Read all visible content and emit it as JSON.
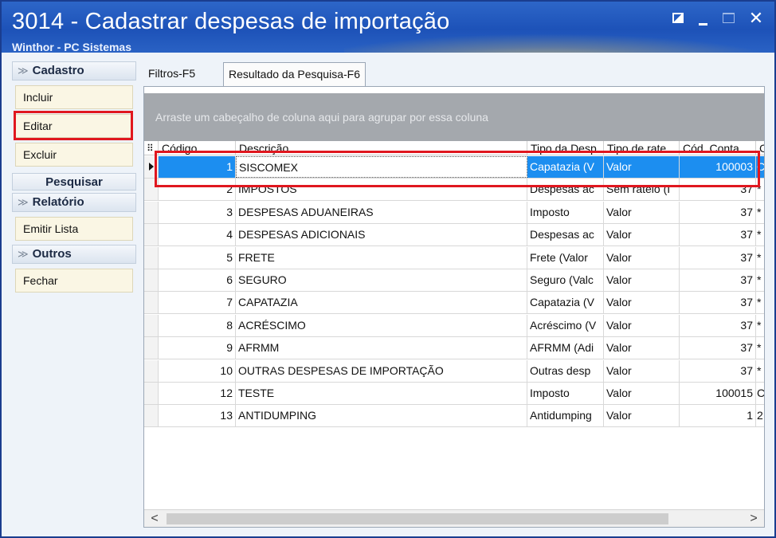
{
  "window": {
    "title": "3014 - Cadastrar despesas de importação",
    "subtitle": "Winthor - PC Sistemas",
    "close_label": "✕"
  },
  "sidebar": {
    "cadastro": {
      "label": "Cadastro",
      "items": [
        "Incluir",
        "Editar",
        "Excluir"
      ]
    },
    "pesquisar": {
      "label": "Pesquisar"
    },
    "relatorio": {
      "label": "Relatório",
      "items": [
        "Emitir Lista"
      ]
    },
    "outros": {
      "label": "Outros",
      "items": [
        "Fechar"
      ]
    }
  },
  "tabs": [
    "Filtros-F5",
    "Resultado da Pesquisa-F6"
  ],
  "grid": {
    "group_hint": "Arraste um cabeçalho de coluna aqui para agrupar por essa coluna",
    "columns": [
      "Código",
      "Descrição",
      "Tipo da Desp",
      "Tipo de rate",
      "Cód. Conta",
      "C"
    ],
    "rows": [
      {
        "codigo": "1",
        "descricao": "SISCOMEX",
        "tipo_desp": "Capatazia (V",
        "tipo_rateio": "Valor",
        "cod_conta": "100003",
        "extra": "C"
      },
      {
        "codigo": "2",
        "descricao": "IMPOSTOS",
        "tipo_desp": "Despesas ac",
        "tipo_rateio": "Sem rateio (I",
        "cod_conta": "37",
        "extra": "*"
      },
      {
        "codigo": "3",
        "descricao": "DESPESAS ADUANEIRAS",
        "tipo_desp": "Imposto",
        "tipo_rateio": "Valor",
        "cod_conta": "37",
        "extra": "*"
      },
      {
        "codigo": "4",
        "descricao": "DESPESAS ADICIONAIS",
        "tipo_desp": "Despesas ac",
        "tipo_rateio": "Valor",
        "cod_conta": "37",
        "extra": "*"
      },
      {
        "codigo": "5",
        "descricao": "FRETE",
        "tipo_desp": "Frete (Valor",
        "tipo_rateio": "Valor",
        "cod_conta": "37",
        "extra": "*"
      },
      {
        "codigo": "6",
        "descricao": "SEGURO",
        "tipo_desp": "Seguro (Valc",
        "tipo_rateio": "Valor",
        "cod_conta": "37",
        "extra": "*"
      },
      {
        "codigo": "7",
        "descricao": "CAPATAZIA",
        "tipo_desp": "Capatazia (V",
        "tipo_rateio": "Valor",
        "cod_conta": "37",
        "extra": "*"
      },
      {
        "codigo": "8",
        "descricao": "ACRÉSCIMO",
        "tipo_desp": "Acréscimo (V",
        "tipo_rateio": "Valor",
        "cod_conta": "37",
        "extra": "*"
      },
      {
        "codigo": "9",
        "descricao": "AFRMM",
        "tipo_desp": "AFRMM (Adi",
        "tipo_rateio": "Valor",
        "cod_conta": "37",
        "extra": "*"
      },
      {
        "codigo": "10",
        "descricao": "OUTRAS DESPESAS DE IMPORTAÇÃO",
        "tipo_desp": "Outras desp",
        "tipo_rateio": "Valor",
        "cod_conta": "37",
        "extra": "*"
      },
      {
        "codigo": "12",
        "descricao": "TESTE",
        "tipo_desp": "Imposto",
        "tipo_rateio": "Valor",
        "cod_conta": "100015",
        "extra": "C"
      },
      {
        "codigo": "13",
        "descricao": "ANTIDUMPING",
        "tipo_desp": "Antidumping",
        "tipo_rateio": "Valor",
        "cod_conta": "1",
        "extra": "2"
      }
    ]
  },
  "scrollbar": {
    "left_arrow": "<",
    "right_arrow": ">"
  },
  "colors": {
    "titlebar": "#1d52b8",
    "selection": "#1c8ef0",
    "highlight": "#e0171f",
    "group_panel": "#a4a8ad"
  }
}
